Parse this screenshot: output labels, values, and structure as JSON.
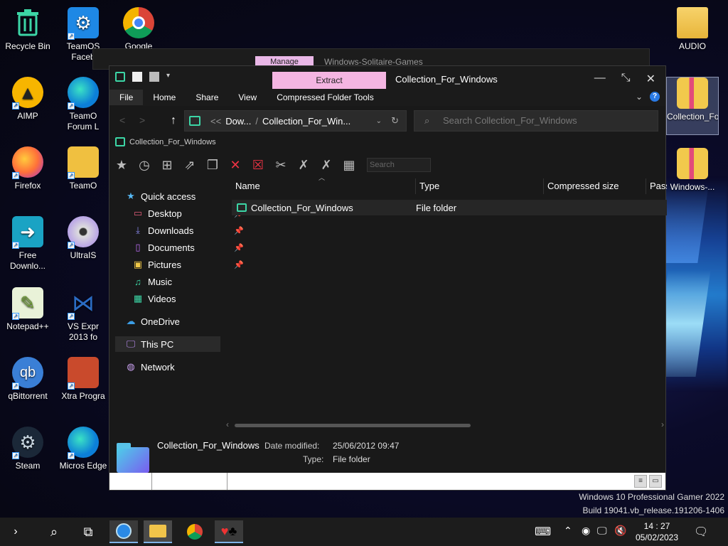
{
  "desktop": {
    "icons": [
      {
        "label": "Recycle Bin"
      },
      {
        "label": "TeamOS Faceb"
      },
      {
        "label": "Google"
      },
      {
        "label": "AIMP"
      },
      {
        "label": "TeamO Forum L"
      },
      {
        "label": "Firefox"
      },
      {
        "label": "TeamO"
      },
      {
        "label": "Free Downlo..."
      },
      {
        "label": "UltraIS"
      },
      {
        "label": "Notepad++"
      },
      {
        "label": "VS Expr 2013 fo"
      },
      {
        "label": "qBittorrent"
      },
      {
        "label": "Xtra Progra"
      },
      {
        "label": "Steam"
      },
      {
        "label": "Micros Edge"
      },
      {
        "label": "AUDIO"
      },
      {
        "label": "Collection_For_Windows"
      },
      {
        "label": "Windows-..."
      }
    ]
  },
  "back_window": {
    "manage_tab": "Manage",
    "title": "Windows-Solitaire-Games"
  },
  "window": {
    "extract_tab": "Extract",
    "title": "Collection_For_Windows",
    "ribbon_tabs": [
      "File",
      "Home",
      "Share",
      "View",
      "Compressed Folder Tools"
    ],
    "address": {
      "chevron": "<<",
      "part1": "Dow...",
      "sep": "/",
      "part2": "Collection_For_Win..."
    },
    "search_placeholder": "Search Collection_For_Windows",
    "breadcrumb2": "Collection_For_Windows",
    "toolbar_search": "Search",
    "nav": {
      "quick_access": "Quick access",
      "desktop": "Desktop",
      "downloads": "Downloads",
      "documents": "Documents",
      "pictures": "Pictures",
      "music": "Music",
      "videos": "Videos",
      "onedrive": "OneDrive",
      "thispc": "This PC",
      "network": "Network"
    },
    "columns": [
      "Name",
      "Type",
      "Compressed size",
      "Pass"
    ],
    "rows": [
      {
        "name": "Collection_For_Windows",
        "type": "File folder"
      }
    ],
    "details": {
      "name": "Collection_For_Windows",
      "date_label": "Date modified:",
      "date_value": "25/06/2012 09:47",
      "type_label": "Type:",
      "type_value": "File folder"
    }
  },
  "watermark": {
    "line1": "Windows 10 Professional Gamer 2022",
    "line2": "Build 19041.vb_release.191206-1406"
  },
  "clock": {
    "time": "14 : 27",
    "date": "05/02/2023"
  },
  "colors": {
    "accent_teal": "#3cd6a6",
    "extract_pink": "#f4b5e2",
    "manage_pink": "#e9b7e7",
    "help_blue": "#2a7ae4"
  }
}
